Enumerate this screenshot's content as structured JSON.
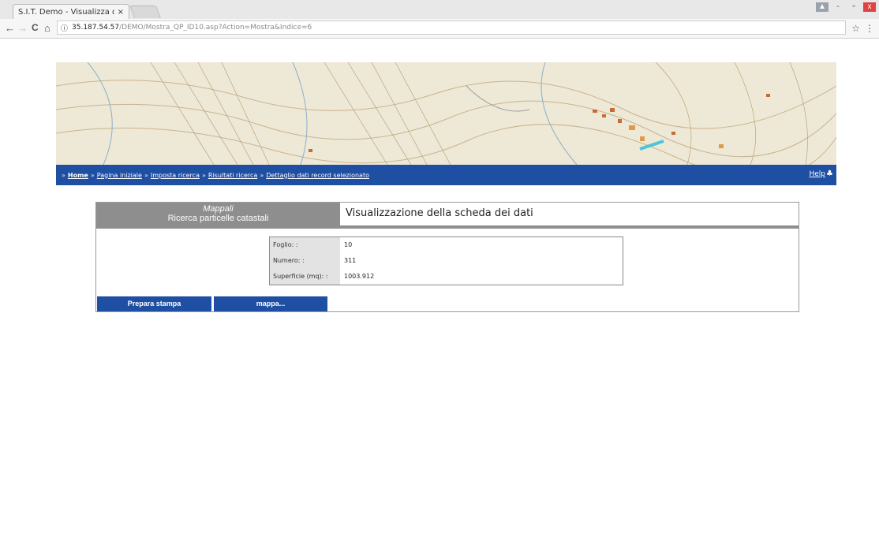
{
  "browser": {
    "tab_title": "S.I.T. Demo - Visualizza d",
    "tab_close": "×",
    "url_host": "35.187.54.57",
    "url_path": "/DEMO/Mostra_QP_ID10.asp?Action=Mostra&Indice=6",
    "back_icon": "←",
    "forward_icon": "→",
    "reload_icon": "C",
    "home_icon": "⌂",
    "info_icon": "ⓘ",
    "star_icon": "☆",
    "menu_icon": "⋮",
    "win_min": "-",
    "win_max": "▫",
    "win_close": "x"
  },
  "breadcrumb": {
    "home": "Home",
    "items": [
      "Pagina iniziale",
      "Imposta ricerca",
      "Risultati ricerca",
      "Dettaglio dati record selezionato"
    ],
    "separator": "»",
    "help": "Help"
  },
  "panel": {
    "subtitle": "Mappali",
    "title": "Ricerca particelle catastali",
    "heading": "Visualizzazione della scheda dei dati"
  },
  "record": [
    {
      "label": "Foglio: :",
      "value": "10"
    },
    {
      "label": "Numero: :",
      "value": "311"
    },
    {
      "label": "Superficie (mq): :",
      "value": "1003.912"
    }
  ],
  "buttons": {
    "print": "Prepara stampa",
    "map": "mappa..."
  },
  "colors": {
    "accent_blue": "#1f4fa3",
    "header_gray": "#8e8e8e"
  }
}
